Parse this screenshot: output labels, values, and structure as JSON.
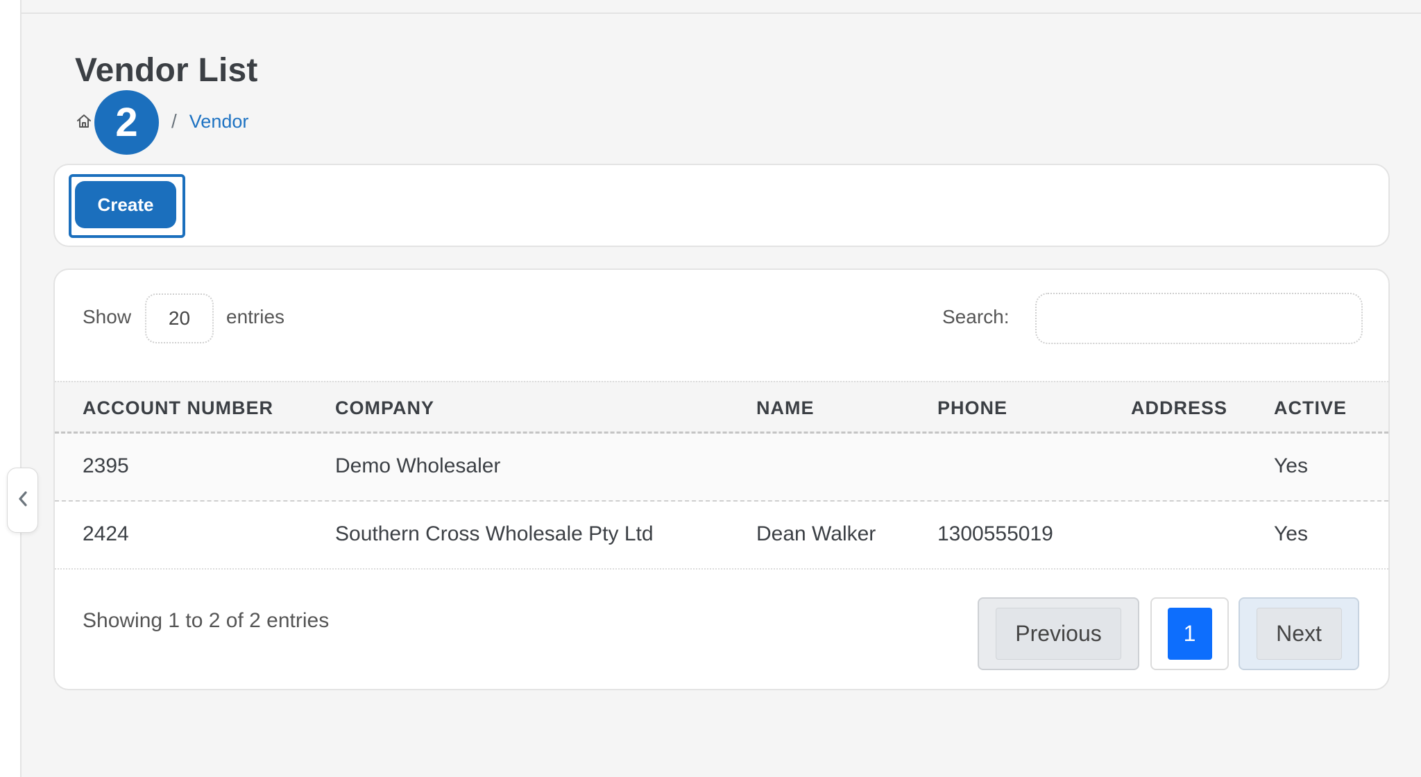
{
  "page": {
    "title": "Vendor List",
    "breadcrumb": {
      "home_icon": "home-icon",
      "separator": "/",
      "current": "Vendor"
    },
    "step_badge": "2"
  },
  "toolbar": {
    "create_label": "Create"
  },
  "table_controls": {
    "show_label": "Show",
    "entries_value": "20",
    "entries_label": "entries",
    "search_label": "Search:",
    "search_value": ""
  },
  "table": {
    "columns": [
      "ACCOUNT NUMBER",
      "COMPANY",
      "NAME",
      "PHONE",
      "ADDRESS",
      "ACTIVE"
    ],
    "rows": [
      {
        "account_number": "2395",
        "company": "Demo Wholesaler",
        "name": "",
        "phone": "",
        "address": "",
        "active": "Yes"
      },
      {
        "account_number": "2424",
        "company": "Southern Cross Wholesale Pty Ltd",
        "name": "Dean Walker",
        "phone": "1300555019",
        "address": "",
        "active": "Yes"
      }
    ]
  },
  "footer": {
    "info": "Showing 1 to 2 of 2 entries",
    "pagination": {
      "previous": "Previous",
      "current_page": "1",
      "next": "Next"
    }
  },
  "colors": {
    "primary": "#1b6fbd",
    "active_page": "#0d6efd",
    "link": "#1d72c2"
  },
  "sidebar_toggle": {
    "icon": "chevron-left-icon"
  }
}
